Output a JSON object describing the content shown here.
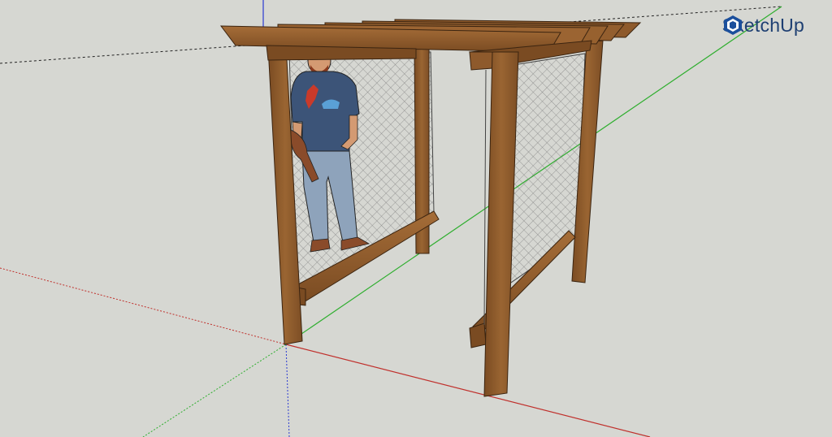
{
  "app": {
    "name": "SketchUp",
    "brand_color": "#1b4f9c"
  },
  "axes": {
    "red_color": "#c0302c",
    "green_color": "#2fae2f",
    "blue_color": "#2b3ad1"
  },
  "scene": {
    "model": "wooden-frame-with-wire-mesh",
    "figure": "human-scale-figure",
    "wood_color": "#8b5a2b",
    "mesh_color": "#6a6a6a"
  }
}
